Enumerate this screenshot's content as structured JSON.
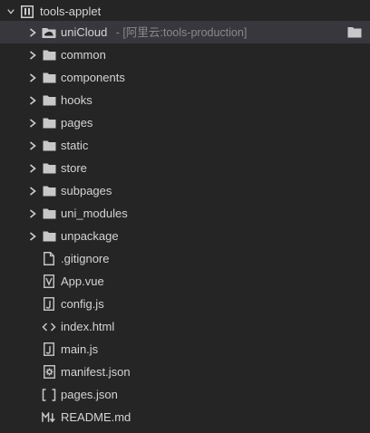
{
  "explorer": {
    "root": {
      "label": "tools-applet",
      "icon": "project-icon"
    },
    "items": [
      {
        "label": "uniCloud",
        "suffix": " - [阿里云:tools-production]",
        "type": "folder",
        "icon": "cloud-folder-icon"
      },
      {
        "label": "common",
        "type": "folder",
        "icon": "folder-icon"
      },
      {
        "label": "components",
        "type": "folder",
        "icon": "folder-icon"
      },
      {
        "label": "hooks",
        "type": "folder",
        "icon": "folder-icon"
      },
      {
        "label": "pages",
        "type": "folder",
        "icon": "folder-icon"
      },
      {
        "label": "static",
        "type": "folder",
        "icon": "folder-icon"
      },
      {
        "label": "store",
        "type": "folder",
        "icon": "folder-icon"
      },
      {
        "label": "subpages",
        "type": "folder",
        "icon": "folder-icon"
      },
      {
        "label": "uni_modules",
        "type": "folder",
        "icon": "folder-icon"
      },
      {
        "label": "unpackage",
        "type": "folder",
        "icon": "folder-icon"
      },
      {
        "label": ".gitignore",
        "type": "file",
        "icon": "file-icon"
      },
      {
        "label": "App.vue",
        "type": "file",
        "icon": "vue-file-icon"
      },
      {
        "label": "config.js",
        "type": "file",
        "icon": "js-file-icon"
      },
      {
        "label": "index.html",
        "type": "file",
        "icon": "html-file-icon"
      },
      {
        "label": "main.js",
        "type": "file",
        "icon": "js-file-icon"
      },
      {
        "label": "manifest.json",
        "type": "file",
        "icon": "settings-file-icon"
      },
      {
        "label": "pages.json",
        "type": "file",
        "icon": "json-file-icon"
      },
      {
        "label": "README.md",
        "type": "file",
        "icon": "markdown-file-icon"
      }
    ],
    "selected_item": "uniCloud",
    "colors": {
      "background": "#252526",
      "selected_row": "#37373d",
      "text": "#d4d4d4",
      "muted_text": "#8a8a8a",
      "icon": "#c8c8c8"
    }
  }
}
